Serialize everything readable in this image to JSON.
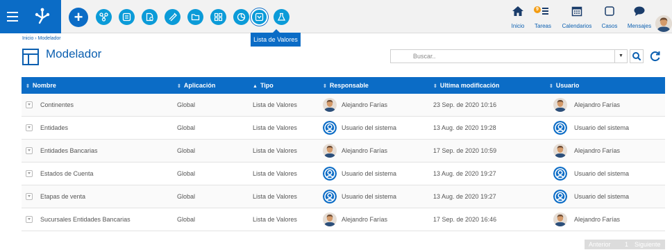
{
  "topbar": {
    "nav": [
      {
        "id": "inicio",
        "label": "Inicio",
        "icon": "home-icon"
      },
      {
        "id": "tareas",
        "label": "Tareas",
        "icon": "tasks-icon",
        "badge": "9"
      },
      {
        "id": "calendarios",
        "label": "Calendarios",
        "icon": "calendar-icon"
      },
      {
        "id": "casos",
        "label": "Casos",
        "icon": "cases-icon"
      },
      {
        "id": "mensajes",
        "label": "Mensajes",
        "icon": "messages-icon"
      }
    ],
    "tooltip": "Lista de Valores",
    "accent": "#0b6cc6",
    "tool_color": "#0b9bd8"
  },
  "header": {
    "breadcrumb": "Inicio › Modelador",
    "title": "Modelador",
    "search_placeholder": "Buscar.."
  },
  "table": {
    "columns": [
      "Nombre",
      "Aplicación",
      "Tipo",
      "Responsable",
      "Ultima modificación",
      "Usuario"
    ],
    "rows": [
      {
        "nombre": "Continentes",
        "aplicacion": "Global",
        "tipo": "Lista de Valores",
        "responsable": "Alejandro Farías",
        "resp_avatar": "person",
        "modificacion": "23 Sep. de 2020 10:16",
        "usuario": "Alejandro Farías",
        "user_avatar": "person"
      },
      {
        "nombre": "Entidades",
        "aplicacion": "Global",
        "tipo": "Lista de Valores",
        "responsable": "Usuario del sistema",
        "resp_avatar": "system",
        "modificacion": "13 Aug. de 2020 19:28",
        "usuario": "Usuario del sistema",
        "user_avatar": "system"
      },
      {
        "nombre": "Entidades Bancarias",
        "aplicacion": "Global",
        "tipo": "Lista de Valores",
        "responsable": "Alejandro Farías",
        "resp_avatar": "person",
        "modificacion": "17 Sep. de 2020 10:59",
        "usuario": "Alejandro Farías",
        "user_avatar": "person"
      },
      {
        "nombre": "Estados de Cuenta",
        "aplicacion": "Global",
        "tipo": "Lista de Valores",
        "responsable": "Usuario del sistema",
        "resp_avatar": "system",
        "modificacion": "13 Aug. de 2020 19:27",
        "usuario": "Usuario del sistema",
        "user_avatar": "system"
      },
      {
        "nombre": "Etapas de venta",
        "aplicacion": "Global",
        "tipo": "Lista de Valores",
        "responsable": "Usuario del sistema",
        "resp_avatar": "system",
        "modificacion": "13 Aug. de 2020 19:27",
        "usuario": "Usuario del sistema",
        "user_avatar": "system"
      },
      {
        "nombre": "Sucursales Entidades Bancarias",
        "aplicacion": "Global",
        "tipo": "Lista de Valores",
        "responsable": "Alejandro Farías",
        "resp_avatar": "person",
        "modificacion": "17 Sep. de 2020 16:46",
        "usuario": "Alejandro Farías",
        "user_avatar": "person"
      }
    ]
  },
  "pager": {
    "prev": "Anterior",
    "page": "1",
    "next": "Siguiente"
  }
}
